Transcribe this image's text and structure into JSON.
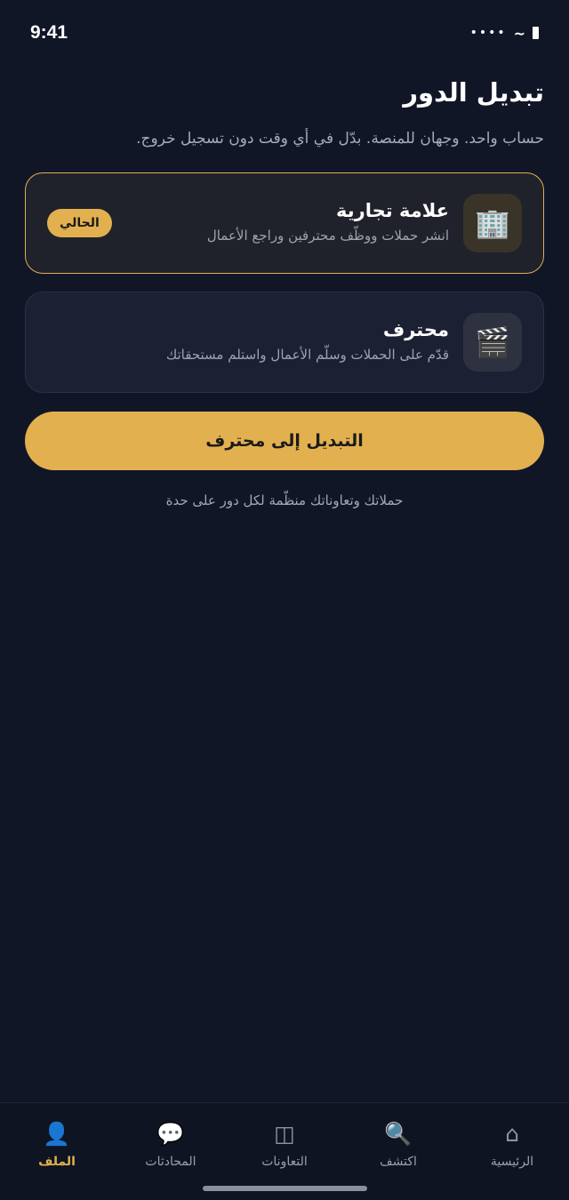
{
  "status": {
    "time": "9:41",
    "signal_icon": "signal-dots-icon",
    "wifi_icon": "wifi-icon",
    "battery_icon": "battery-icon"
  },
  "page": {
    "title": "تبديل الدور",
    "subtitle": "حساب واحد. وجهان للمنصة. بدّل في أي وقت دون تسجيل خروج."
  },
  "roles": [
    {
      "title": "علامة تجارية",
      "description": "انشر حملات ووظّف محترفين وراجع الأعمال",
      "icon": "🏢",
      "icon_name": "office-building-icon",
      "badge": "الحالي",
      "selected": true
    },
    {
      "title": "محترف",
      "description": "قدّم على الحملات وسلّم الأعمال واستلم مستحقاتك",
      "icon": "🎬",
      "icon_name": "clapperboard-icon",
      "selected": false
    }
  ],
  "switch_button_label": "التبديل إلى محترف",
  "hint": "حملاتك وتعاوناتك منظّمة لكل دور على حدة",
  "tabs": [
    {
      "label": "الرئيسية",
      "icon": "⌂",
      "icon_name": "home-icon",
      "active": false
    },
    {
      "label": "اكتشف",
      "icon": "🔍",
      "icon_name": "search-icon",
      "active": false
    },
    {
      "label": "التعاونات",
      "icon": "◫",
      "icon_name": "collaborations-icon",
      "active": false
    },
    {
      "label": "المحادثات",
      "icon": "💬",
      "icon_name": "chat-icon",
      "active": false
    },
    {
      "label": "الملف",
      "icon": "👤",
      "icon_name": "profile-icon",
      "active": true
    }
  ],
  "colors": {
    "background": "#111627",
    "accent": "#e2b04f",
    "card_selected": "#1f222b",
    "card": "#1b2133"
  }
}
